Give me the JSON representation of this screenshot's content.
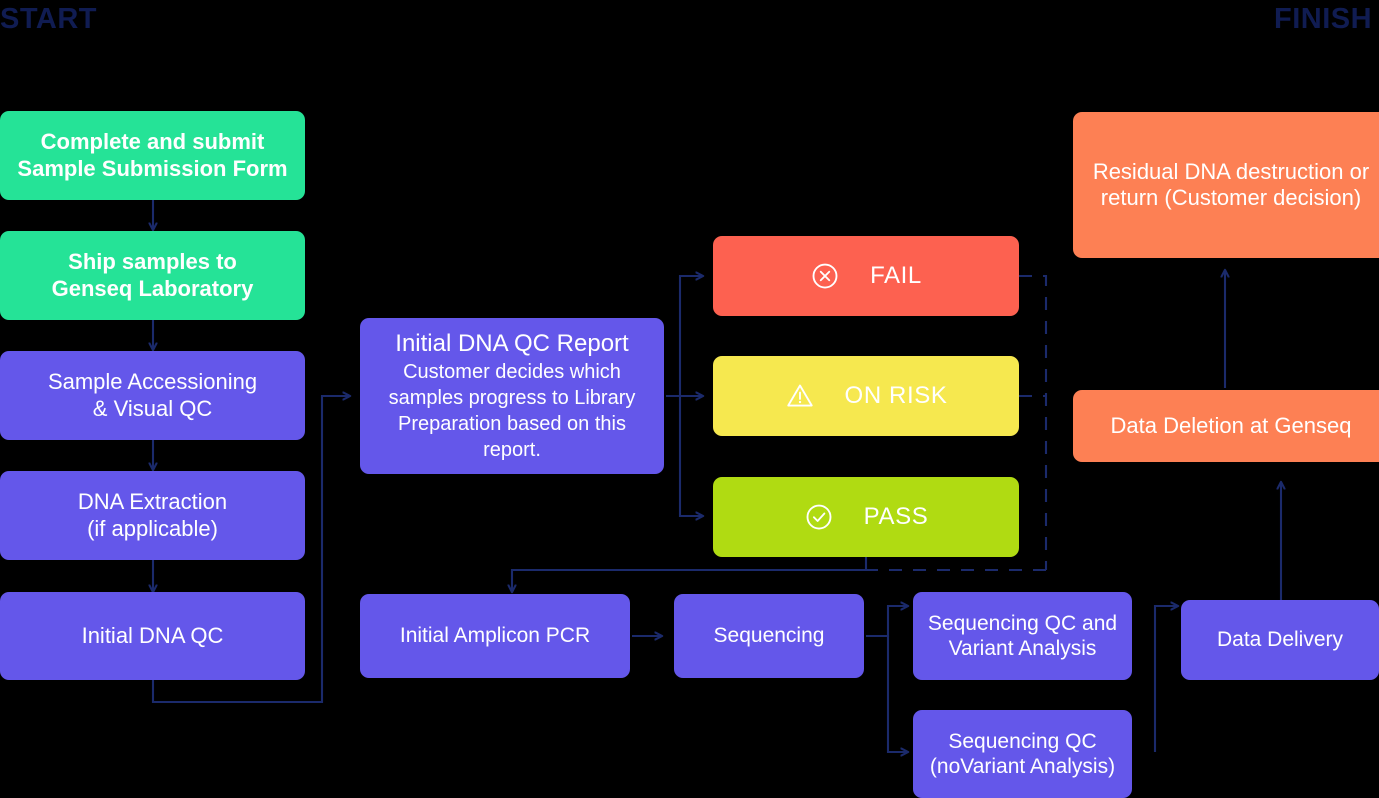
{
  "labels": {
    "start": "START",
    "finish": "FINISH"
  },
  "colors": {
    "background": "#000000",
    "navy": "#101c52",
    "arrow": "#1b2a6b",
    "green": "#25e397",
    "violet": "#6457ea",
    "orange": "#fd8054",
    "red": "#fd6150",
    "yellow": "#f6e84f",
    "lime": "#b0db12",
    "text": "#ffffff"
  },
  "nodes": {
    "submit_form": "Complete and submit\nSample Submission Form",
    "ship_samples": "Ship samples to\nGenseq Laboratory",
    "sample_accessioning": "Sample Accessioning\n& Visual QC",
    "dna_extraction": "DNA Extraction\n(if applicable)",
    "initial_dna_qc": "Initial DNA QC",
    "report_title": "Initial DNA QC Report",
    "report_body": "Customer decides which samples progress to Library Preparation based on this report.",
    "fail": "FAIL",
    "on_risk": "ON RISK",
    "pass": "PASS",
    "residual_dna": "Residual DNA destruction or return (Customer decision)",
    "data_deletion": "Data Deletion at Genseq",
    "initial_amplicon_pcr": "Initial Amplicon PCR",
    "sequencing": "Sequencing",
    "seq_qc_variant": "Sequencing QC and\nVariant Analysis",
    "seq_qc_novariant": "Sequencing QC\n(noVariant Analysis)",
    "data_delivery": "Data Delivery"
  },
  "icons": {
    "fail": "circle-x-icon",
    "on_risk": "warning-triangle-icon",
    "pass": "circle-check-icon"
  }
}
